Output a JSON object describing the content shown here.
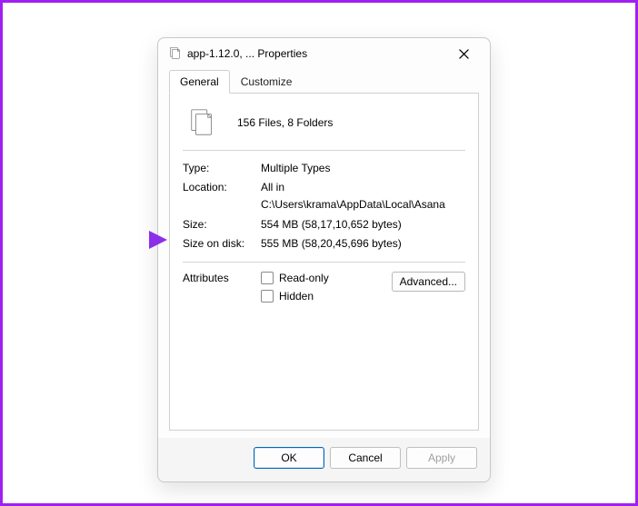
{
  "window": {
    "title": "app-1.12.0, ... Properties"
  },
  "tabs": {
    "general": "General",
    "customize": "Customize"
  },
  "summary": {
    "count": "156 Files, 8 Folders"
  },
  "fields": {
    "type_label": "Type:",
    "type_value": "Multiple Types",
    "location_label": "Location:",
    "location_value": "All in C:\\Users\\krama\\AppData\\Local\\Asana",
    "size_label": "Size:",
    "size_value": "554 MB (58,17,10,652 bytes)",
    "sizeondisk_label": "Size on disk:",
    "sizeondisk_value": "555 MB (58,20,45,696 bytes)"
  },
  "attributes": {
    "label": "Attributes",
    "readonly": "Read-only",
    "hidden": "Hidden",
    "advanced": "Advanced..."
  },
  "buttons": {
    "ok": "OK",
    "cancel": "Cancel",
    "apply": "Apply"
  }
}
